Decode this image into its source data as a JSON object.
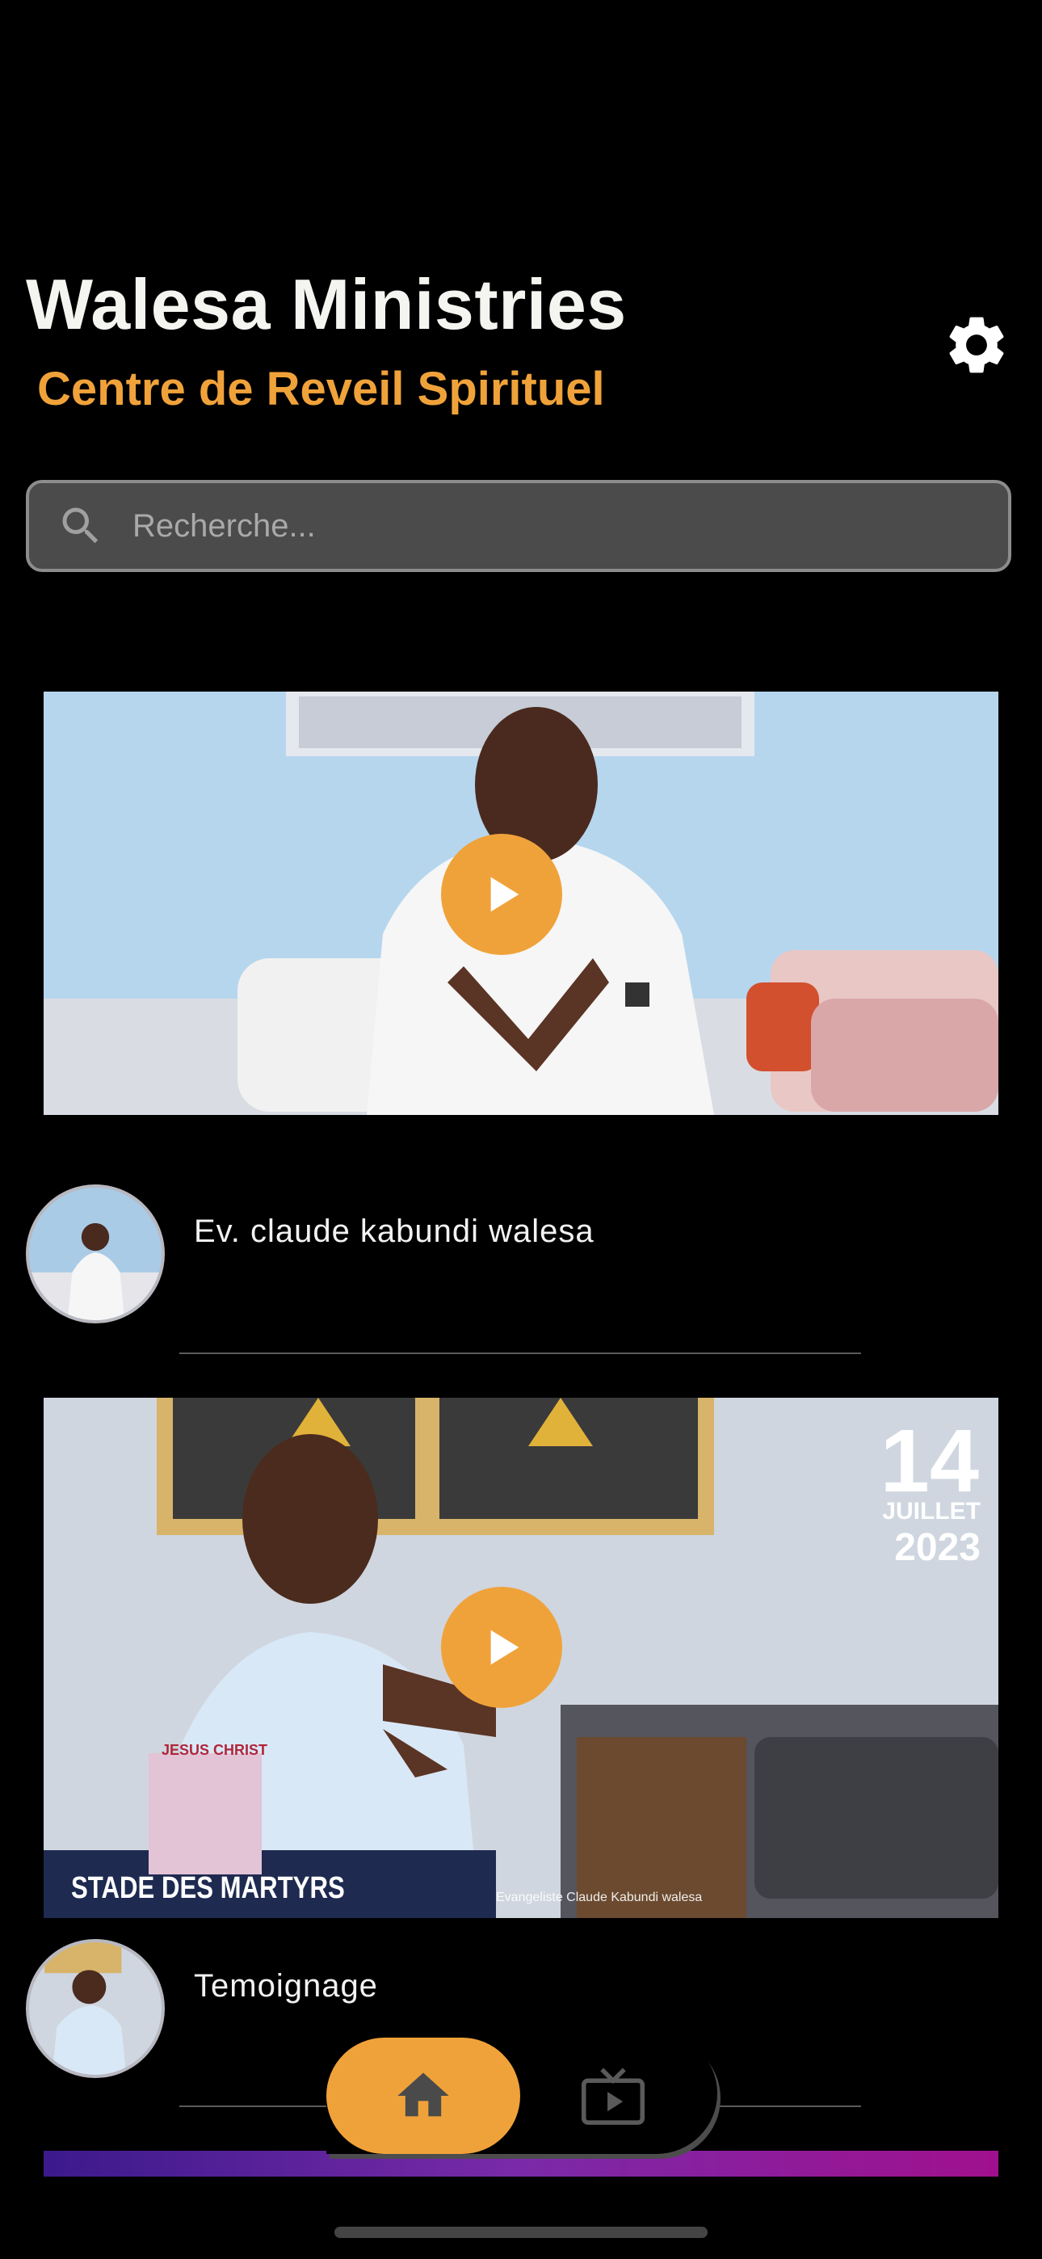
{
  "header": {
    "title": "Walesa Ministries",
    "subtitle": "Centre de Reveil Spirituel",
    "settings_icon": "gear-icon"
  },
  "search": {
    "placeholder": "Recherche...",
    "value": "",
    "icon": "search-icon"
  },
  "videos": [
    {
      "title": "Ev. claude kabundi walesa",
      "play_icon": "play-icon"
    },
    {
      "title": "Temoignage",
      "play_icon": "play-icon",
      "overlay_day": "14",
      "overlay_month": "JUILLET",
      "overlay_year": "2023",
      "overlay_venue": "STADE DES MARTYRS",
      "overlay_banner": "JESUS CHRIST",
      "overlay_social": "Evangeliste Claude Kabundi walesa"
    }
  ],
  "bottom_nav": {
    "items": [
      {
        "name": "home",
        "icon": "home-icon",
        "active": true
      },
      {
        "name": "tv",
        "icon": "tv-play-icon",
        "active": false
      }
    ]
  },
  "colors": {
    "accent": "#f0a23a",
    "background": "#000000",
    "search_bg": "#4b4b4b"
  }
}
